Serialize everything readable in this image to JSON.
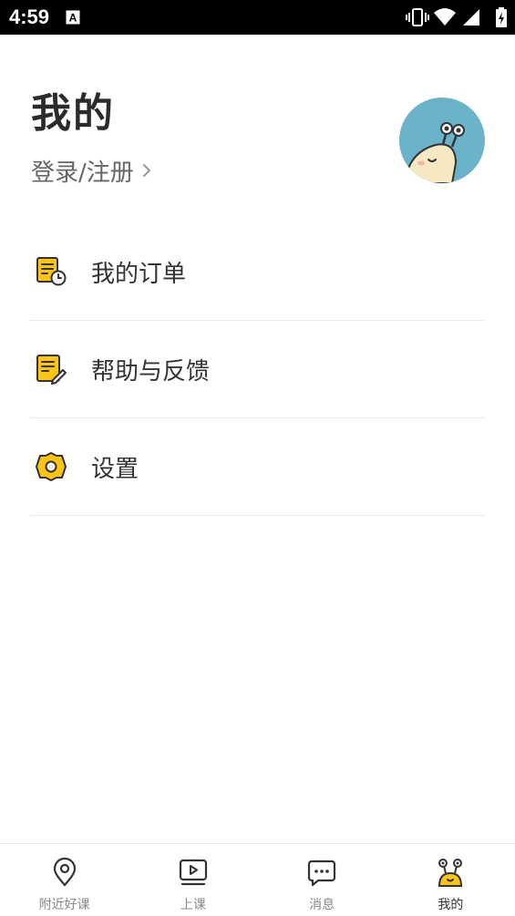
{
  "status_bar": {
    "time": "4:59",
    "icons": [
      "keyboard-a-icon",
      "vibrate-icon",
      "wifi-icon",
      "signal-icon",
      "battery-icon"
    ]
  },
  "header": {
    "title": "我的",
    "login_label": "登录/注册"
  },
  "menu": {
    "items": [
      {
        "label": "我的订单",
        "icon": "order-list-icon"
      },
      {
        "label": "帮助与反馈",
        "icon": "feedback-edit-icon"
      },
      {
        "label": "设置",
        "icon": "settings-gear-icon"
      }
    ]
  },
  "tabs": [
    {
      "label": "附近好课",
      "icon": "location-pin-icon",
      "active": false
    },
    {
      "label": "上课",
      "icon": "video-play-icon",
      "active": false
    },
    {
      "label": "消息",
      "icon": "chat-bubble-icon",
      "active": false
    },
    {
      "label": "我的",
      "icon": "snail-mascot-icon",
      "active": true
    }
  ],
  "colors": {
    "accent_yellow": "#FCC419",
    "avatar_bg": "#6BB3C9",
    "text_primary": "#333333",
    "text_secondary": "#888888"
  }
}
